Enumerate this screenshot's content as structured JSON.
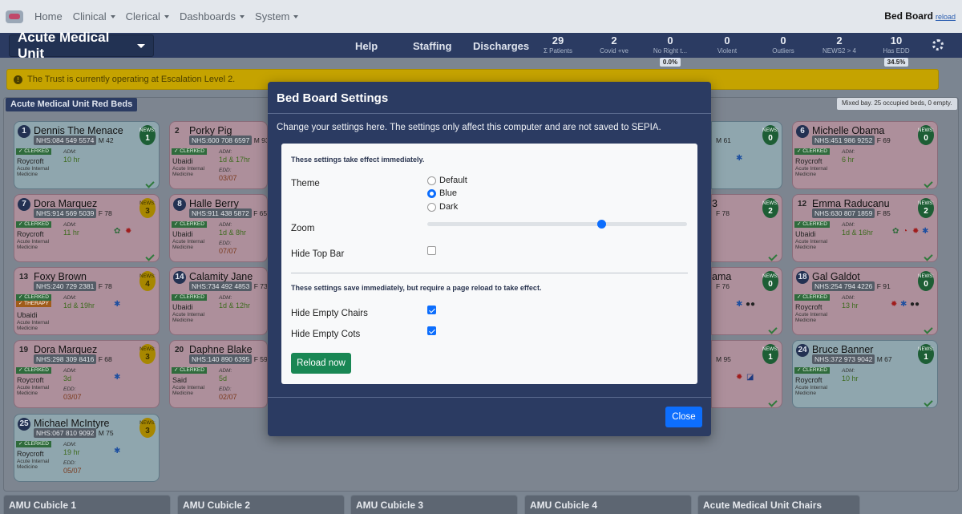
{
  "nav": {
    "items": [
      {
        "label": "Home",
        "dropdown": false
      },
      {
        "label": "Clinical",
        "dropdown": true
      },
      {
        "label": "Clerical",
        "dropdown": true
      },
      {
        "label": "Dashboards",
        "dropdown": true
      },
      {
        "label": "System",
        "dropdown": true
      }
    ],
    "page_title": "Bed Board",
    "reload_link": "reload"
  },
  "ward_bar": {
    "ward_name": "Acute Medical Unit",
    "links": [
      "Help",
      "Staffing",
      "Discharges"
    ],
    "stats": [
      {
        "value": "29",
        "label": "Σ Patients"
      },
      {
        "value": "2",
        "label": "Covid +ve"
      },
      {
        "value": "0",
        "label": "No Right t...",
        "pct": "0.0%"
      },
      {
        "value": "0",
        "label": "Violent"
      },
      {
        "value": "0",
        "label": "Outliers"
      },
      {
        "value": "2",
        "label": "NEWS2 > 4"
      },
      {
        "value": "10",
        "label": "Has EDD",
        "pct": "34.5%"
      }
    ]
  },
  "alert": {
    "text": "The Trust is currently operating at Escalation Level 2."
  },
  "panel": {
    "title": "Acute Medical Unit Red Beds",
    "note": "Mixed bay. 25 occupied beds, 0 empty."
  },
  "beds": [
    {
      "bed": "1",
      "name": "Dennis The Menace",
      "nhs": "NHS:084 549 5574",
      "sex": "M 42",
      "news": "1",
      "clerked": "✓ CLERKED",
      "consultant": "Roycroft",
      "specialty": "Acute Internal Medicine",
      "adm_label": "ADM:",
      "adm": "10 hr"
    },
    {
      "bed": "2",
      "name": "Porky Pig",
      "nhs": "NHS:600 708 6597",
      "sex": "M 93",
      "clerked": "✓ CLERKED",
      "consultant": "Ubaidi",
      "specialty": "Acute Internal Medicine",
      "adm_label": "ADM:",
      "adm": "1d & 17hr",
      "edd_label": "EDD:",
      "edd": "03/07"
    },
    {
      "bed": "6",
      "name": "Michelle Obama",
      "nhs": "NHS:451 986 9252",
      "sex": "F 69",
      "news": "0",
      "clerked": "✓ CLERKED",
      "consultant": "Roycroft",
      "specialty": "Acute Internal Medicine",
      "adm_label": "ADM:",
      "adm": "6 hr"
    },
    {
      "bed": "7",
      "name": "Dora Marquez",
      "nhs": "NHS:914 569 5039",
      "sex": "F 78",
      "news": "3",
      "clerked": "✓ CLERKED",
      "consultant": "Roycroft",
      "specialty": "Acute Internal Medicine",
      "adm_label": "ADM:",
      "adm": "11 hr"
    },
    {
      "bed": "8",
      "name": "Halle Berry",
      "nhs": "NHS:911 438 5872",
      "sex": "F 65",
      "clerked": "✓ CLERKED",
      "consultant": "Ubaidi",
      "specialty": "Acute Internal Medicine",
      "adm_label": "ADM:",
      "adm": "1d & 8hr",
      "edd_label": "EDD:",
      "edd": "07/07"
    },
    {
      "bed": "12",
      "name": "Emma Raducanu",
      "nhs": "NHS:630 807 1859",
      "sex": "F 85",
      "news": "2",
      "clerked": "✓ CLERKED",
      "consultant": "Ubaidi",
      "specialty": "Acute Internal Medicine",
      "adm_label": "ADM:",
      "adm": "1d & 16hr"
    },
    {
      "bed": "13",
      "name": "Foxy Brown",
      "nhs": "NHS:240 729 2381",
      "sex": "F 78",
      "news": "4",
      "clerked": "✓ CLERKED",
      "therapy": "✓ THERAPY",
      "consultant": "Ubaidi",
      "specialty": "Acute Internal Medicine",
      "adm_label": "ADM:",
      "adm": "1d & 19hr"
    },
    {
      "bed": "14",
      "name": "Calamity Jane",
      "nhs": "NHS:734 492 4853",
      "sex": "F 73",
      "clerked": "✓ CLERKED",
      "consultant": "Ubaidi",
      "specialty": "Acute Internal Medicine",
      "adm_label": "ADM:",
      "adm": "1d & 12hr"
    },
    {
      "bed": "18",
      "name": "Gal Galdot",
      "nhs": "NHS:254 794 4226",
      "sex": "F 91",
      "news": "0",
      "clerked": "✓ CLERKED",
      "consultant": "Roycroft",
      "specialty": "Acute Internal Medicine",
      "adm_label": "ADM:",
      "adm": "13 hr"
    },
    {
      "bed": "19",
      "name": "Dora Marquez",
      "nhs": "NHS:298 309 8416",
      "sex": "F 68",
      "news": "3",
      "clerked": "✓ CLERKED",
      "consultant": "Roycroft",
      "specialty": "Acute Internal Medicine",
      "adm_label": "ADM:",
      "adm": "3d",
      "edd_label": "EDD:",
      "edd": "03/07"
    },
    {
      "bed": "20",
      "name": "Daphne Blake",
      "nhs": "NHS:140 890 6395",
      "sex": "F 59",
      "clerked": "✓ CLERKED",
      "consultant": "Said",
      "specialty": "Acute Internal Medicine",
      "adm_label": "ADM:",
      "adm": "5d",
      "edd_label": "EDD:",
      "edd": "02/07"
    },
    {
      "bed": "24",
      "name": "Bruce Banner",
      "nhs": "NHS:372 973 9042",
      "sex": "M 67",
      "news": "1",
      "clerked": "✓ CLERKED",
      "consultant": "Roycroft",
      "specialty": "Acute Internal Medicine",
      "adm_label": "ADM:",
      "adm": "10 hr"
    },
    {
      "bed": "25",
      "name": "Michael McIntyre",
      "nhs": "NHS:067 810 9092",
      "sex": "M 75",
      "news": "3",
      "clerked": "✓ CLERKED",
      "consultant": "Roycroft",
      "specialty": "Acute Internal Medicine",
      "adm_label": "ADM:",
      "adm": "19 hr",
      "edd_label": "EDD:",
      "edd": "05/07"
    }
  ],
  "partial_beds": [
    {
      "sex": "M 61",
      "news": "0"
    },
    {
      "name_fragment": "3",
      "sex": "F 78",
      "news": "2"
    },
    {
      "name_fragment": "ama",
      "sex": "F 76",
      "news": "0"
    },
    {
      "sex": "M 95",
      "news": "1"
    }
  ],
  "bottom_tabs": [
    "AMU Cubicle 1",
    "AMU Cubicle 2",
    "AMU Cubicle 3",
    "AMU Cubicle 4",
    "Acute Medical Unit Chairs"
  ],
  "modal": {
    "title": "Bed Board Settings",
    "subtitle": "Change your settings here. The settings only affect this computer and are not saved to SEPIA.",
    "section1_note": "These settings take effect immediately.",
    "theme_label": "Theme",
    "theme_options": [
      "Default",
      "Blue",
      "Dark"
    ],
    "theme_selected": "Blue",
    "zoom_label": "Zoom",
    "zoom_level": 0.67,
    "hide_top_bar_label": "Hide Top Bar",
    "hide_top_bar": false,
    "section2_note": "These settings save immediately, but require a page reload to take effect.",
    "hide_empty_chairs_label": "Hide Empty Chairs",
    "hide_empty_chairs": true,
    "hide_empty_cots_label": "Hide Empty Cots",
    "hide_empty_cots": true,
    "reload_button": "Reload now",
    "close_button": "Close"
  },
  "colors": {
    "navy": "#2b3b62",
    "alert": "#c5a300",
    "primary": "#0d6efd",
    "success": "#198754"
  }
}
